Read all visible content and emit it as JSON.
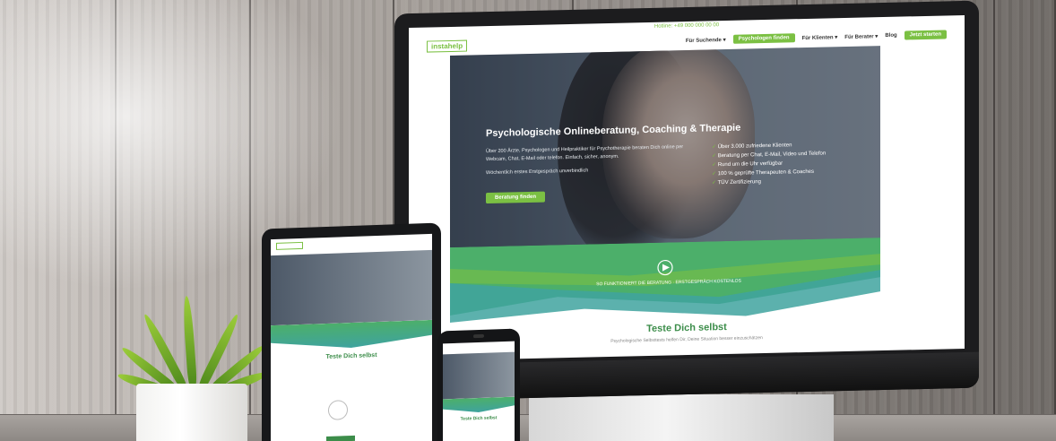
{
  "monitor": {
    "topbar": "Hotline: +49 000 000 00 00",
    "logo": "instahelp",
    "nav": [
      "Für Suchende ▾",
      "Psychologen finden",
      "Für Klienten ▾",
      "Für Berater ▾",
      "Blog"
    ],
    "nav_button": "Jetzt starten",
    "hero_title": "Psychologische Onlineberatung, Coaching & Therapie",
    "hero_text": "Über 200 Ärzte, Psychologen und Heilpraktiker für Psychotherapie beraten Dich online per Webcam, Chat, E-Mail oder telefon. Einfach, sicher, anonym.",
    "hero_sub": "Wöchentlich erstes Erstgespräch unverbindlich",
    "hero_cta": "Beratung finden",
    "checks": [
      "Über 3.000 zufriedene Klienten",
      "Beratung per Chat, E-Mail, Video und Telefon",
      "Rund um die Uhr verfügbar",
      "100 % geprüfte Therapeuten & Coaches",
      "TÜV Zertifizierung"
    ],
    "band_text": "SO FUNKTIONIERT DIE BERATUNG   ·   ERSTGESPRÄCH KOSTENLOS",
    "section_title": "Teste Dich selbst",
    "section_sub": "Psychologische Selbsttests helfen Dir, Deine Situation besser einzuschätzen"
  },
  "tablet": {
    "title": "Teste Dich selbst"
  },
  "phone": {
    "title": "Teste Dich selbst"
  },
  "colors": {
    "brand_green": "#7bc043",
    "teal": "#3fa39f",
    "monitor_bezel": "#1c1c1e"
  }
}
